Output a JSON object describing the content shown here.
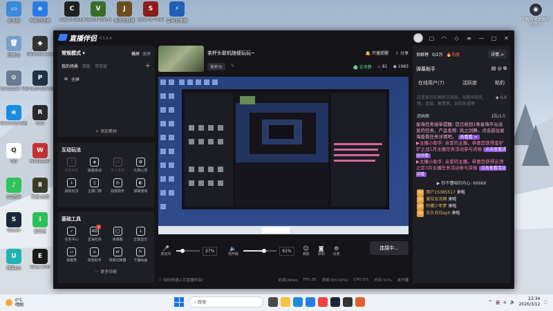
{
  "desktop": {
    "icons_col1": [
      {
        "label": "此电脑",
        "color": "#3c8ad8",
        "glyph": "▭",
        "icon": "computer-icon"
      },
      {
        "label": "回收站",
        "color": "#7aa0c8",
        "glyph": "🗑",
        "icon": "recycle-bin-icon"
      },
      {
        "label": "Computer Man...",
        "color": "#6a7c92",
        "glyph": "⚙",
        "icon": "computer-management-icon"
      },
      {
        "label": "Microsoft Edge",
        "color": "#1d8ce0",
        "glyph": "e",
        "icon": "edge-icon"
      },
      {
        "label": "QQ",
        "color": "#ffffff",
        "glyph": "🐧",
        "icon": "qq-icon"
      },
      {
        "label": "QQ音乐",
        "color": "#30c35b",
        "glyph": "♪",
        "icon": "qq-music-icon"
      },
      {
        "label": "Steam",
        "color": "#1b2838",
        "glyph": "S",
        "icon": "steam-icon"
      },
      {
        "label": "网易UU",
        "color": "#22b3b0",
        "glyph": "U",
        "icon": "uu-icon"
      }
    ],
    "icons_col2": [
      {
        "label": "神秘浏览器",
        "color": "#2a7be4",
        "glyph": "e",
        "icon": "browser-icon"
      },
      {
        "label": "Paradox Launcher v2",
        "color": "#333333",
        "glyph": "◆",
        "icon": "paradox-icon"
      },
      {
        "label": "Phasmophobia",
        "color": "#223344",
        "glyph": "P",
        "icon": "phasmophobia-icon"
      },
      {
        "label": "Raft",
        "color": "#2a2a2a",
        "glyph": "R",
        "icon": "raft-icon"
      },
      {
        "label": "Wallpaper",
        "color": "#c43030",
        "glyph": "W",
        "icon": "wallpaper-icon"
      },
      {
        "label": "天国:拯救",
        "color": "#3b3b2a",
        "glyph": "Ⅱ",
        "icon": "kingdom-come-icon"
      },
      {
        "label": "爱奇艺",
        "color": "#2ec05c",
        "glyph": "i",
        "icon": "iqiyi-icon"
      },
      {
        "label": "Easy Anti",
        "color": "#1a1a1a",
        "glyph": "E",
        "icon": "easyanti-icon"
      }
    ],
    "icons_top": [
      {
        "label": "Call of Duty",
        "color": "#202020",
        "glyph": "C",
        "icon": "cod-icon"
      },
      {
        "label": "Grand Theft Auto V",
        "color": "#3a6e28",
        "glyph": "V",
        "icon": "gta-icon"
      },
      {
        "label": "侏罗纪世界",
        "color": "#6b4d1f",
        "glyph": "J",
        "icon": "jurassic-icon"
      },
      {
        "label": "Sons Of The Forest",
        "color": "#8b1c1c",
        "glyph": "S",
        "icon": "sons-forest-icon"
      },
      {
        "label": "雷神加速器",
        "color": "#1f5fb8",
        "glyph": "⚡",
        "icon": "leishen-icon"
      }
    ],
    "right_icon": {
      "label": "了解有关此图片的信息",
      "icon": "info-camera-icon"
    }
  },
  "app": {
    "name": "直播伴侣",
    "version": "6.5.5.4",
    "left": {
      "mode_title": "常规模式",
      "mode_tabs": [
        "横屏",
        "竖屏"
      ],
      "scene_tabs": [
        "我的场景",
        "双街",
        "可欢迎"
      ],
      "scene_item": "全屏",
      "add_material": "+ 添加素材",
      "interactive_title": "互动玩法",
      "interactive": [
        {
          "label": "猜猜谁是",
          "icon": "guess-icon",
          "dim": true
        },
        {
          "label": "磁盘挑战",
          "icon": "shield-icon",
          "dim": false
        },
        {
          "label": "多人连麦",
          "icon": "multi-mic-icon",
          "dim": true
        },
        {
          "label": "礼物心愿",
          "icon": "gift-icon",
          "dim": false
        },
        {
          "label": "接收玩法",
          "icon": "download-icon",
          "dim": false
        },
        {
          "label": "主播门牌",
          "icon": "door-icon",
          "dim": false
        },
        {
          "label": "贴纸助手",
          "icon": "sticker-icon",
          "dim": false
        },
        {
          "label": "弹幕游戏",
          "icon": "game-icon",
          "dim": false
        }
      ],
      "tools_title": "基础工具",
      "tools": [
        {
          "label": "任务中心",
          "icon": "task-icon",
          "badge": ""
        },
        {
          "label": "星海任务",
          "icon": "ad-icon",
          "badge": "1"
        },
        {
          "label": "读弹幕",
          "icon": "read-danmaku-icon",
          "badge": ""
        },
        {
          "label": "正版音乐",
          "icon": "music-icon",
          "badge": ""
        },
        {
          "label": "弹幕秀",
          "icon": "danmaku-show-icon",
          "badge": ""
        },
        {
          "label": "房管助手",
          "icon": "admin-icon",
          "badge": ""
        },
        {
          "label": "场景切换器",
          "icon": "scene-switch-icon",
          "badge": ""
        },
        {
          "label": "下播绘画",
          "icon": "paint-icon",
          "badge": ""
        }
      ],
      "more": "更多功能"
    },
    "center": {
      "stream_title": "茶杯头联机随便玩玩~",
      "tag": "茶杯头",
      "open_reminder": "开播提醒",
      "share": "分享",
      "audience_label": "全场静",
      "likes": "81",
      "viewers": "1983",
      "mic_label": "麦克风",
      "mic_pct": "27%",
      "mic_level": 0.27,
      "speaker_label": "扬声器",
      "speaker_pct": "61%",
      "speaker_level": 0.61,
      "beauty": "美颜",
      "record": "录制",
      "settings": "设置",
      "go_live": "连接中...",
      "tip": "如何快速上手直播伴侣?",
      "status": [
        "码率:0kb/s",
        "FPS:30",
        "丢帧:0(0.00%)",
        "CPU:5%",
        "内存:51%",
        "未开播"
      ]
    },
    "right": {
      "rank_label": "贡献榜",
      "rank_value": "0/2万",
      "hot": "热度",
      "detail": "详情 >",
      "assistant_title": "弹幕助手",
      "tabs": [
        "在线用户(7)",
        "活跃度",
        "粘豹"
      ],
      "hint": "这里显示礼物状况消息，如粉丝和礼物，连接，售票等，钻石助通等",
      "badge_value": "0.0",
      "sub_left": "进画面",
      "sub_right": "1队/1人",
      "messages": [
        {
          "text": "星海任务接单提醒: 您已收到1条星海平台派发的任务，产品名称: 风之剑舞，点击前往星海查看任务详情吧。",
          "cls": "sys",
          "btn": "去看看 >"
        },
        {
          "text": "主播小助手: 亲爱的主播，恭喜您获得金铲铲之战1月主播任务活动参与资格",
          "cls": "pink",
          "btn": "点击查看活动详情"
        },
        {
          "text": "主播小助手: 亲爱的主播，恭喜您获得云顶之弈3月主播任务活动参与资格",
          "cls": "pink",
          "btn": "点击查看活动详情"
        }
      ],
      "jump_msg": "你不懂咱的内心: 66666",
      "users": [
        {
          "lv": "10",
          "name": "用户1S385517",
          "act": "来啦"
        },
        {
          "lv": "10",
          "name": "爱拉五次翔",
          "act": "来啦"
        },
        {
          "lv": "10",
          "name": "柠檬少年梦",
          "act": "来啦"
        },
        {
          "lv": "10",
          "name": "亦久亦归ayh",
          "act": "来啦"
        }
      ]
    }
  },
  "taskbar": {
    "weather_temp": "0°C",
    "weather_desc": "晴朗",
    "search_placeholder": "搜索",
    "lang": "英",
    "time": "22:34",
    "date": "2026/3/12"
  }
}
